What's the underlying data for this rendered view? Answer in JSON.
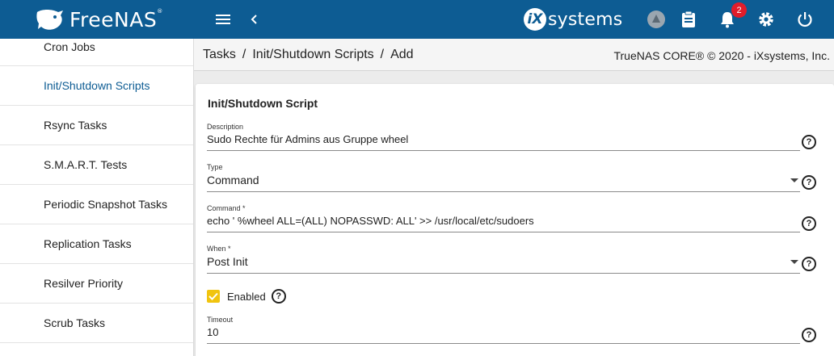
{
  "app": {
    "brand": "FreeNAS",
    "brand_mark": "®",
    "vendor": "systems",
    "vendor_prefix": "iX",
    "notification_count": "2",
    "accent": "#0d5c93"
  },
  "sidebar": {
    "items": [
      {
        "label": "Cron Jobs",
        "active": false
      },
      {
        "label": "Init/Shutdown Scripts",
        "active": true
      },
      {
        "label": "Rsync Tasks",
        "active": false
      },
      {
        "label": "S.M.A.R.T. Tests",
        "active": false
      },
      {
        "label": "Periodic Snapshot Tasks",
        "active": false
      },
      {
        "label": "Replication Tasks",
        "active": false
      },
      {
        "label": "Resilver Priority",
        "active": false
      },
      {
        "label": "Scrub Tasks",
        "active": false
      }
    ]
  },
  "breadcrumb": {
    "items": [
      "Tasks",
      "Init/Shutdown Scripts",
      "Add"
    ],
    "separator": "/"
  },
  "copyright": "TrueNAS CORE® © 2020 - iXsystems, Inc.",
  "form": {
    "title": "Init/Shutdown Script",
    "description": {
      "label": "Description",
      "value": "Sudo Rechte für Admins aus Gruppe wheel"
    },
    "type": {
      "label": "Type",
      "value": "Command"
    },
    "command": {
      "label": "Command *",
      "value": "echo ' %wheel ALL=(ALL) NOPASSWD: ALL' >>  /usr/local/etc/sudoers"
    },
    "when": {
      "label": "When *",
      "value": "Post Init"
    },
    "enabled": {
      "label": "Enabled",
      "checked": true
    },
    "timeout": {
      "label": "Timeout",
      "value": "10"
    },
    "help_glyph": "?"
  }
}
